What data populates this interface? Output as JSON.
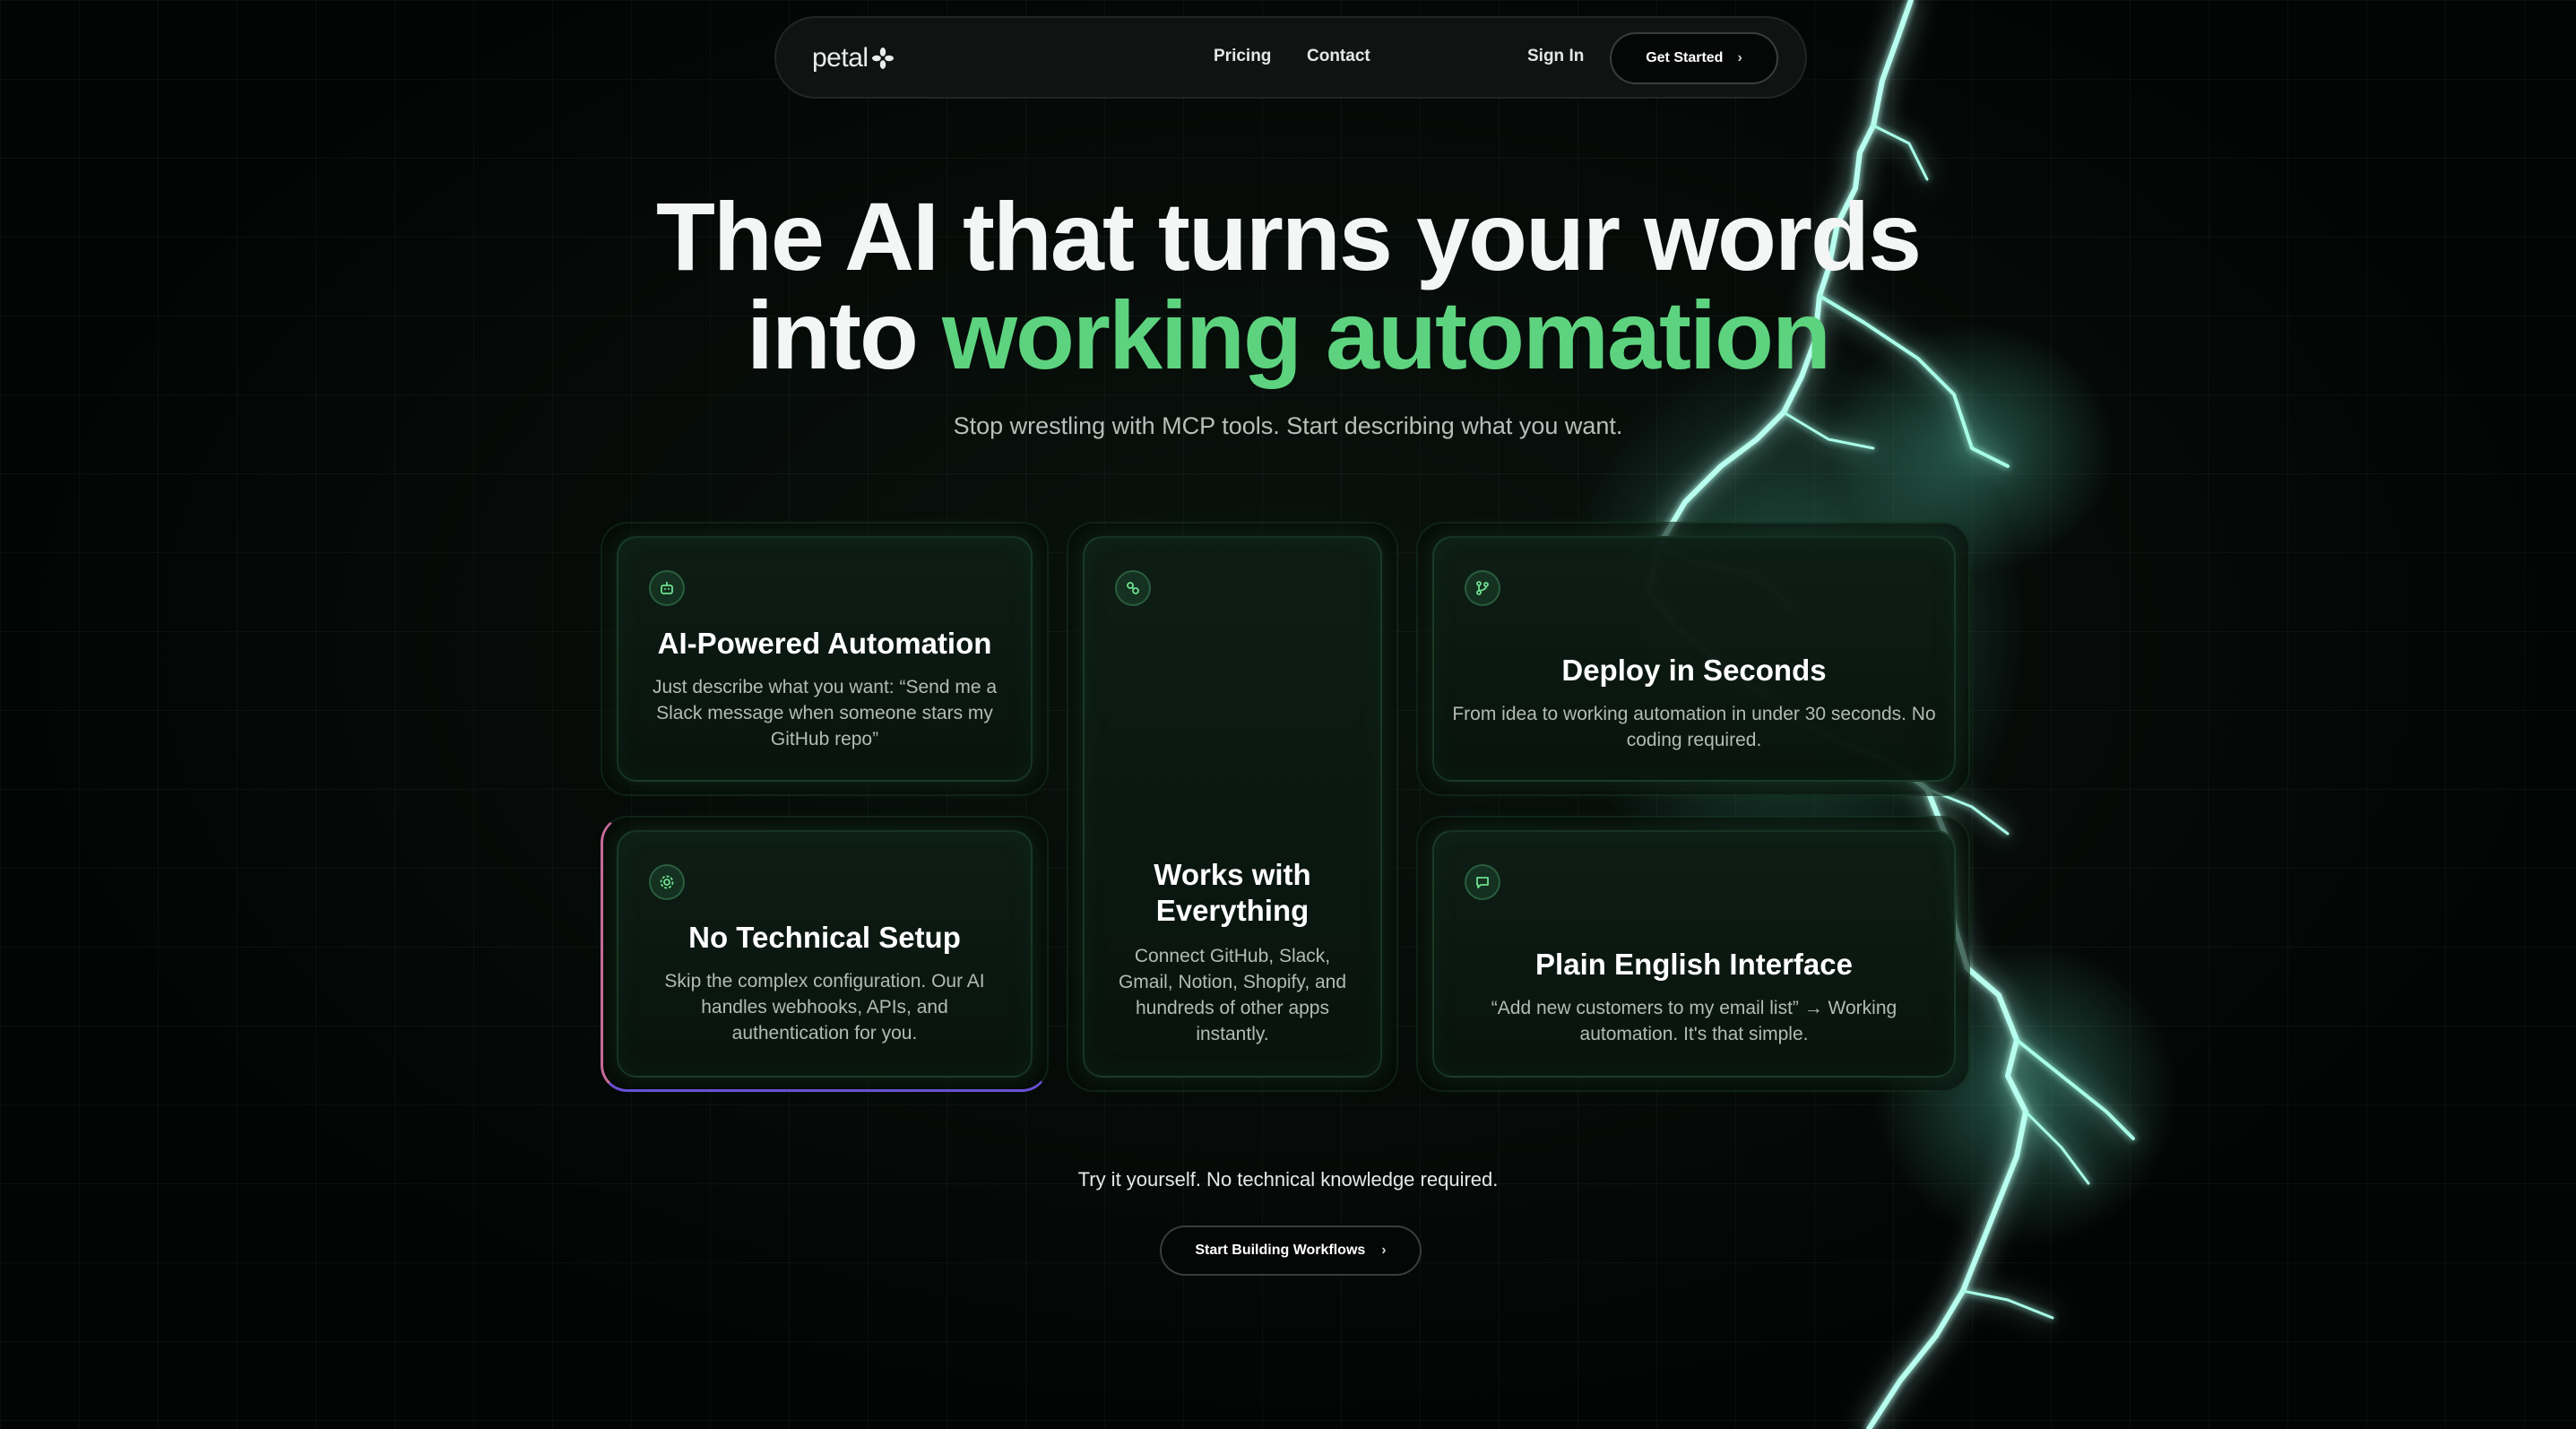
{
  "nav": {
    "logo_text": "petal",
    "links": [
      "Pricing",
      "Contact"
    ],
    "sign_in": "Sign In",
    "cta": "Get Started"
  },
  "hero": {
    "title_line1": "The AI that turns your words",
    "title_line2_prefix": "into ",
    "title_line2_highlight": "working automation",
    "subtitle": "Stop wrestling with MCP tools. Start describing what you want."
  },
  "features": [
    {
      "icon": "robot-icon",
      "title": "AI-Powered Automation",
      "desc": "Just describe what you want: “Send me a Slack message when someone stars my GitHub repo”"
    },
    {
      "icon": "link-icon",
      "title": "Works with Everything",
      "desc": "Connect GitHub, Slack, Gmail, Notion, Shopify, and hundreds of other apps instantly."
    },
    {
      "icon": "git-branch-icon",
      "title": "Deploy in Seconds",
      "desc": "From idea to working automation in under 30 seconds. No coding required."
    },
    {
      "icon": "gear-icon",
      "title": "No Technical Setup",
      "desc": "Skip the complex configuration. Our AI handles webhooks, APIs, and authentication for you."
    },
    {
      "icon": "chat-icon",
      "title": "Plain English Interface",
      "desc": "“Add new customers to my email list” → Working automation. It's that simple."
    }
  ],
  "cta": {
    "text": "Try it yourself. No technical knowledge required.",
    "button": "Start Building Workflows"
  },
  "colors": {
    "accent_green": "#5dd37f",
    "bolt": "#7ff7d7",
    "background": "#040605"
  }
}
